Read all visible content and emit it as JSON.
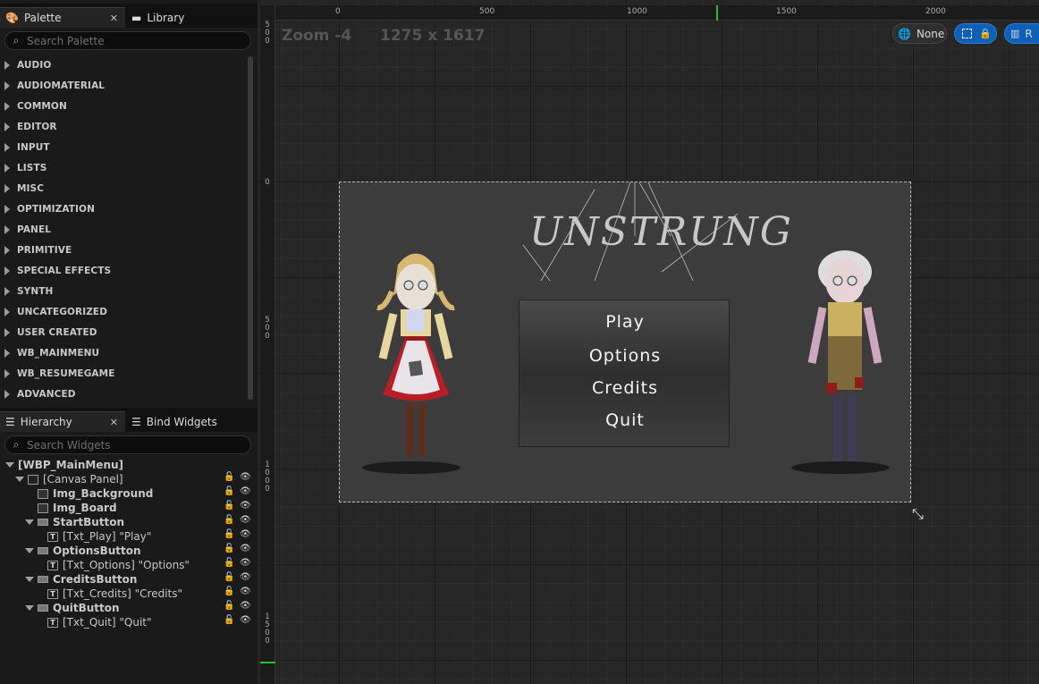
{
  "palette_tabs": {
    "palette": "Palette",
    "library": "Library"
  },
  "palette_search": {
    "placeholder": "Search Palette"
  },
  "palette_categories": [
    "AUDIO",
    "AUDIOMATERIAL",
    "COMMON",
    "EDITOR",
    "INPUT",
    "LISTS",
    "MISC",
    "OPTIMIZATION",
    "PANEL",
    "PRIMITIVE",
    "SPECIAL EFFECTS",
    "SYNTH",
    "UNCATEGORIZED",
    "USER CREATED",
    "WB_MAINMENU",
    "WB_RESUMEGAME",
    "ADVANCED"
  ],
  "hierarchy_tabs": {
    "hierarchy": "Hierarchy",
    "bind_widgets": "Bind Widgets"
  },
  "hierarchy_search": {
    "placeholder": "Search Widgets"
  },
  "hierarchy": [
    {
      "label": "[WBP_MainMenu]",
      "depth": 0,
      "bold": true,
      "caret": true,
      "icon": "none",
      "controls": false
    },
    {
      "label": "[Canvas Panel]",
      "depth": 1,
      "bold": false,
      "caret": true,
      "icon": "canvas-icon",
      "controls": true
    },
    {
      "label": "Img_Background",
      "depth": 2,
      "bold": true,
      "caret": false,
      "icon": "image-icon",
      "controls": true
    },
    {
      "label": "Img_Board",
      "depth": 2,
      "bold": true,
      "caret": false,
      "icon": "image-icon",
      "controls": true
    },
    {
      "label": "StartButton",
      "depth": 2,
      "bold": true,
      "caret": true,
      "icon": "button-icon",
      "controls": true
    },
    {
      "label": "[Txt_Play] \"Play\"",
      "depth": 3,
      "bold": false,
      "caret": false,
      "icon": "text-icon",
      "controls": true
    },
    {
      "label": "OptionsButton",
      "depth": 2,
      "bold": true,
      "caret": true,
      "icon": "button-icon",
      "controls": true
    },
    {
      "label": "[Txt_Options] \"Options\"",
      "depth": 3,
      "bold": false,
      "caret": false,
      "icon": "text-icon",
      "controls": true
    },
    {
      "label": "CreditsButton",
      "depth": 2,
      "bold": true,
      "caret": true,
      "icon": "button-icon",
      "controls": true
    },
    {
      "label": "[Txt_Credits] \"Credits\"",
      "depth": 3,
      "bold": false,
      "caret": false,
      "icon": "text-icon",
      "controls": true
    },
    {
      "label": "QuitButton",
      "depth": 2,
      "bold": true,
      "caret": true,
      "icon": "button-icon",
      "controls": true
    },
    {
      "label": "[Txt_Quit] \"Quit\"",
      "depth": 3,
      "bold": false,
      "caret": false,
      "icon": "text-icon",
      "controls": true
    }
  ],
  "viewport": {
    "zoom": "Zoom -4",
    "resolution": "1275 x 1617",
    "ruler_top": [
      "0",
      "500",
      "1000",
      "1500",
      "2000"
    ],
    "ruler_left": [
      "5\n0\n0",
      "0",
      "5\n0\n0",
      "1\n0\n0\n0",
      "1\n5\n0\n0"
    ],
    "world_button": "None",
    "r_label": "R"
  },
  "game_menu": {
    "logo": "UNSTRUNG",
    "play": "Play",
    "options": "Options",
    "credits": "Credits",
    "quit": "Quit"
  },
  "colors": {
    "accent": "#0d5fb8",
    "panel": "#1a1a1a",
    "viewport": "#262626"
  }
}
